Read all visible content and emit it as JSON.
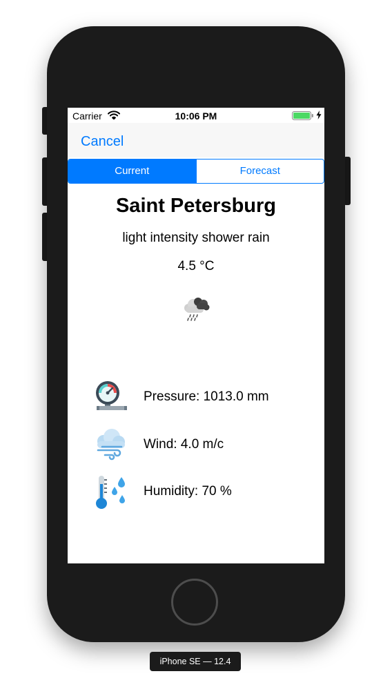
{
  "status_bar": {
    "carrier": "Carrier",
    "time": "10:06 PM",
    "battery_color": "#4cd964"
  },
  "nav": {
    "cancel_label": "Cancel",
    "accent_color": "#007aff"
  },
  "segments": [
    {
      "label": "Current",
      "selected": true
    },
    {
      "label": "Forecast",
      "selected": false
    }
  ],
  "weather": {
    "city": "Saint Petersburg",
    "description": "light intensity shower rain",
    "temperature": "4.5 °C",
    "icon": "cloud-rain-icon"
  },
  "details": [
    {
      "icon": "pressure-gauge-icon",
      "label": "Pressure: 1013.0 mm"
    },
    {
      "icon": "wind-cloud-icon",
      "label": "Wind: 4.0 m/c"
    },
    {
      "icon": "thermometer-humidity-icon",
      "label": "Humidity: 70 %"
    }
  ],
  "device": {
    "label": "iPhone SE — 12.4"
  }
}
